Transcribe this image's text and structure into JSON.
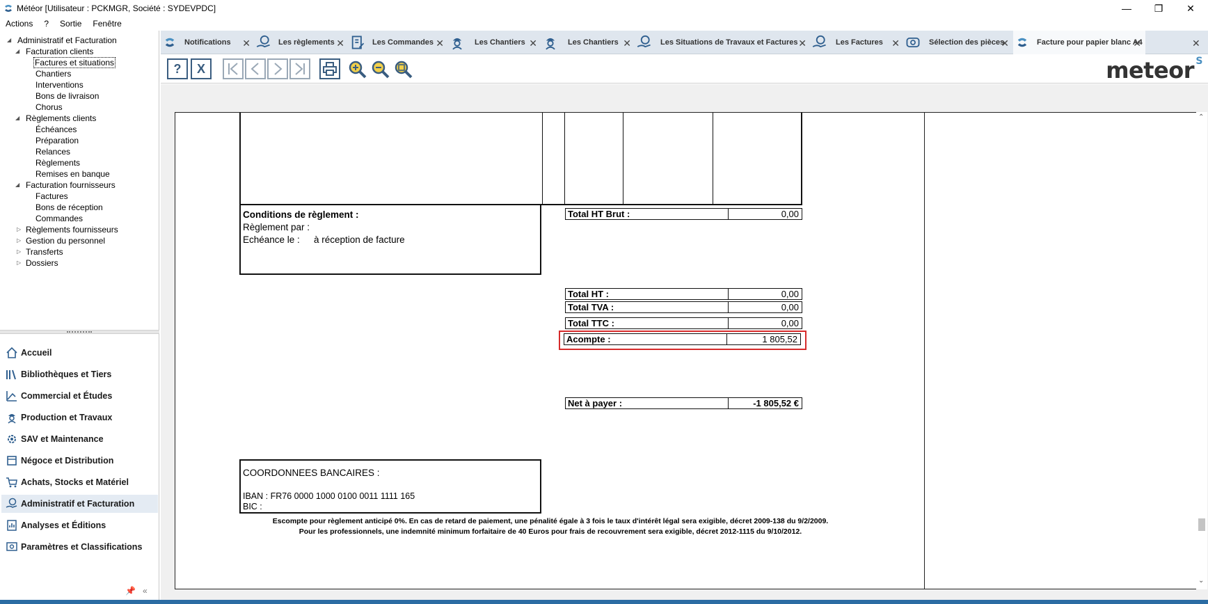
{
  "window": {
    "title": "Météor [Utilisateur : PCKMGR, Société : SYDEVPDC]",
    "controls": {
      "minimize": "—",
      "restore": "❐",
      "close": "✕"
    }
  },
  "menu": [
    "Actions",
    "?",
    "Sortie",
    "Fenêtre"
  ],
  "tree": [
    {
      "label": "Administratif et Facturation",
      "arrow": "◢"
    },
    {
      "label": "Facturation clients",
      "arrow": "◢"
    },
    {
      "label": "Factures et situations"
    },
    {
      "label": "Chantiers"
    },
    {
      "label": "Interventions"
    },
    {
      "label": "Bons de livraison"
    },
    {
      "label": "Chorus"
    },
    {
      "label": "Règlements clients",
      "arrow": "◢"
    },
    {
      "label": "Échéances"
    },
    {
      "label": "Préparation"
    },
    {
      "label": "Relances"
    },
    {
      "label": "Règlements"
    },
    {
      "label": "Remises en banque"
    },
    {
      "label": "Facturation fournisseurs",
      "arrow": "◢"
    },
    {
      "label": "Factures"
    },
    {
      "label": "Bons de réception"
    },
    {
      "label": "Commandes"
    },
    {
      "label": "Règlements fournisseurs",
      "arrow": "▷"
    },
    {
      "label": "Gestion du personnel",
      "arrow": "▷"
    },
    {
      "label": "Transferts",
      "arrow": "▷"
    },
    {
      "label": "Dossiers",
      "arrow": "▷"
    }
  ],
  "nav": [
    {
      "label": "Accueil",
      "icon": "home-icon"
    },
    {
      "label": "Bibliothèques et Tiers",
      "icon": "books-icon"
    },
    {
      "label": "Commercial et Études",
      "icon": "chart-icon"
    },
    {
      "label": "Production et Travaux",
      "icon": "worker-icon"
    },
    {
      "label": "SAV et Maintenance",
      "icon": "gear-icon"
    },
    {
      "label": "Négoce et Distribution",
      "icon": "box-icon"
    },
    {
      "label": "Achats, Stocks et Matériel",
      "icon": "cart-icon"
    },
    {
      "label": "Administratif et Facturation",
      "icon": "money-hand-icon"
    },
    {
      "label": "Analyses et Éditions",
      "icon": "report-icon"
    },
    {
      "label": "Paramètres et Classifications",
      "icon": "settings-icon"
    }
  ],
  "tabs": [
    {
      "label": "Notifications",
      "icon": "meteor-logo-icon"
    },
    {
      "label": "Les règlements",
      "icon": "money-hand-icon"
    },
    {
      "label": "Les Commandes",
      "icon": "order-icon"
    },
    {
      "label": "Les Chantiers",
      "icon": "worker-icon"
    },
    {
      "label": "Les Chantiers",
      "icon": "worker-icon"
    },
    {
      "label": "Les Situations de Travaux et Factures",
      "icon": "money-hand-icon"
    },
    {
      "label": "Les Factures",
      "icon": "money-hand-icon"
    },
    {
      "label": "Sélection des pièces",
      "icon": "selection-icon"
    },
    {
      "label": "Facture pour papier blanc A4",
      "icon": "meteor-logo-icon",
      "active": true
    }
  ],
  "toolbar": {
    "help": "?",
    "close": "X",
    "zoom_in": "+",
    "zoom_out": "−",
    "zoom_fit": "□"
  },
  "brand": {
    "name": "meteor",
    "mark": "S"
  },
  "invoice": {
    "conditions_title": "Conditions de règlement :",
    "reglement_par": "Règlement par :",
    "echeance_label": "Echéance le :",
    "echeance_value": "à réception de facture",
    "totals": [
      {
        "label": "Total HT Brut :",
        "value": "0,00"
      },
      {
        "label": "Total HT :",
        "value": "0,00"
      },
      {
        "label": "Total TVA :",
        "value": "0,00"
      },
      {
        "label": "Total TTC :",
        "value": "0,00"
      },
      {
        "label": "Acompte :",
        "value": "1 805,52"
      }
    ],
    "net_label": "Net à payer :",
    "net_value": "-1 805,52 €",
    "bank_title": "COORDONNEES BANCAIRES :",
    "iban": "IBAN : FR76 0000 1000 0100 0011 1111 165",
    "bic": "BIC :",
    "footer1": "Escompte pour règlement anticipé 0%. En cas de retard de paiement, une pénalité égale à 3 fois le taux d'intérêt légal sera exigible, décret 2009-138 du 9/2/2009.",
    "footer2": "Pour les professionnels, une indemnité minimum forfaitaire de 40 Euros pour frais de recouvrement sera exigible, décret 2012-1115 du 9/10/2012."
  },
  "colors": {
    "accent": "#2f5f8f",
    "highlight": "#d62b2b",
    "taskbar": "#2b6ca3"
  }
}
